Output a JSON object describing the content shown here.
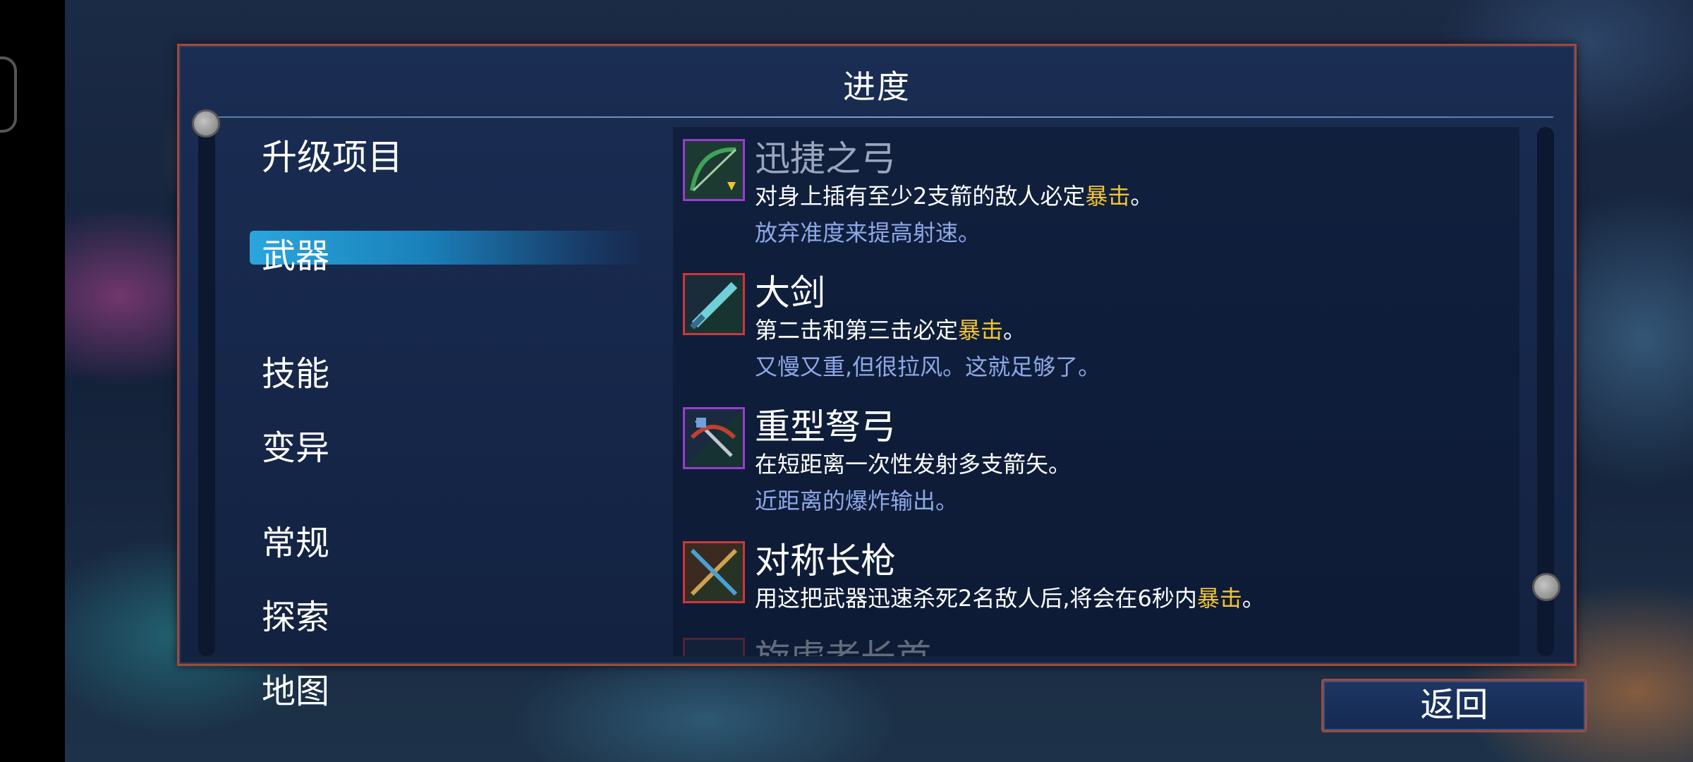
{
  "panel": {
    "title": "进度"
  },
  "nav": {
    "header": "升级项目",
    "items": [
      "武器",
      "技能",
      "变异",
      "常规",
      "探索",
      "地图"
    ],
    "active_index": 0
  },
  "list": {
    "items": [
      {
        "title": "迅捷之弓",
        "desc_prefix": "对身上插有至少2支箭的敌人必定",
        "desc_highlight": "暴击",
        "desc_suffix": "。",
        "flavor": "放弃准度来提高射速。",
        "icon": "swift-bow-icon",
        "frame_color": "#9a3bd0"
      },
      {
        "title": "大剑",
        "desc_prefix": "第二击和第三击必定",
        "desc_highlight": "暴击",
        "desc_suffix": "。",
        "flavor": "又慢又重,但很拉风。这就足够了。",
        "icon": "broadsword-icon",
        "frame_color": "#d0353b"
      },
      {
        "title": "重型弩弓",
        "desc": "在短距离一次性发射多支箭矢。",
        "flavor": "近距离的爆炸输出。",
        "icon": "heavy-crossbow-icon",
        "frame_color": "#9a3bd0"
      },
      {
        "title": "对称长枪",
        "desc_prefix": "用这把武器迅速杀死2名敌人后,将会在6秒内",
        "desc_highlight": "暴击",
        "desc_suffix": "。",
        "icon": "symmetrical-lance-icon",
        "frame_color": "#d0353b"
      },
      {
        "title": "旋虐者长首",
        "icon": "partial-item-icon",
        "frame_color": "#d0353b"
      }
    ]
  },
  "back_button": {
    "label": "返回"
  },
  "colors": {
    "highlight": "#f2c433",
    "flavor": "#8fa8e6",
    "frame": "#a04a3a",
    "active_nav": "#2aa6dc"
  }
}
